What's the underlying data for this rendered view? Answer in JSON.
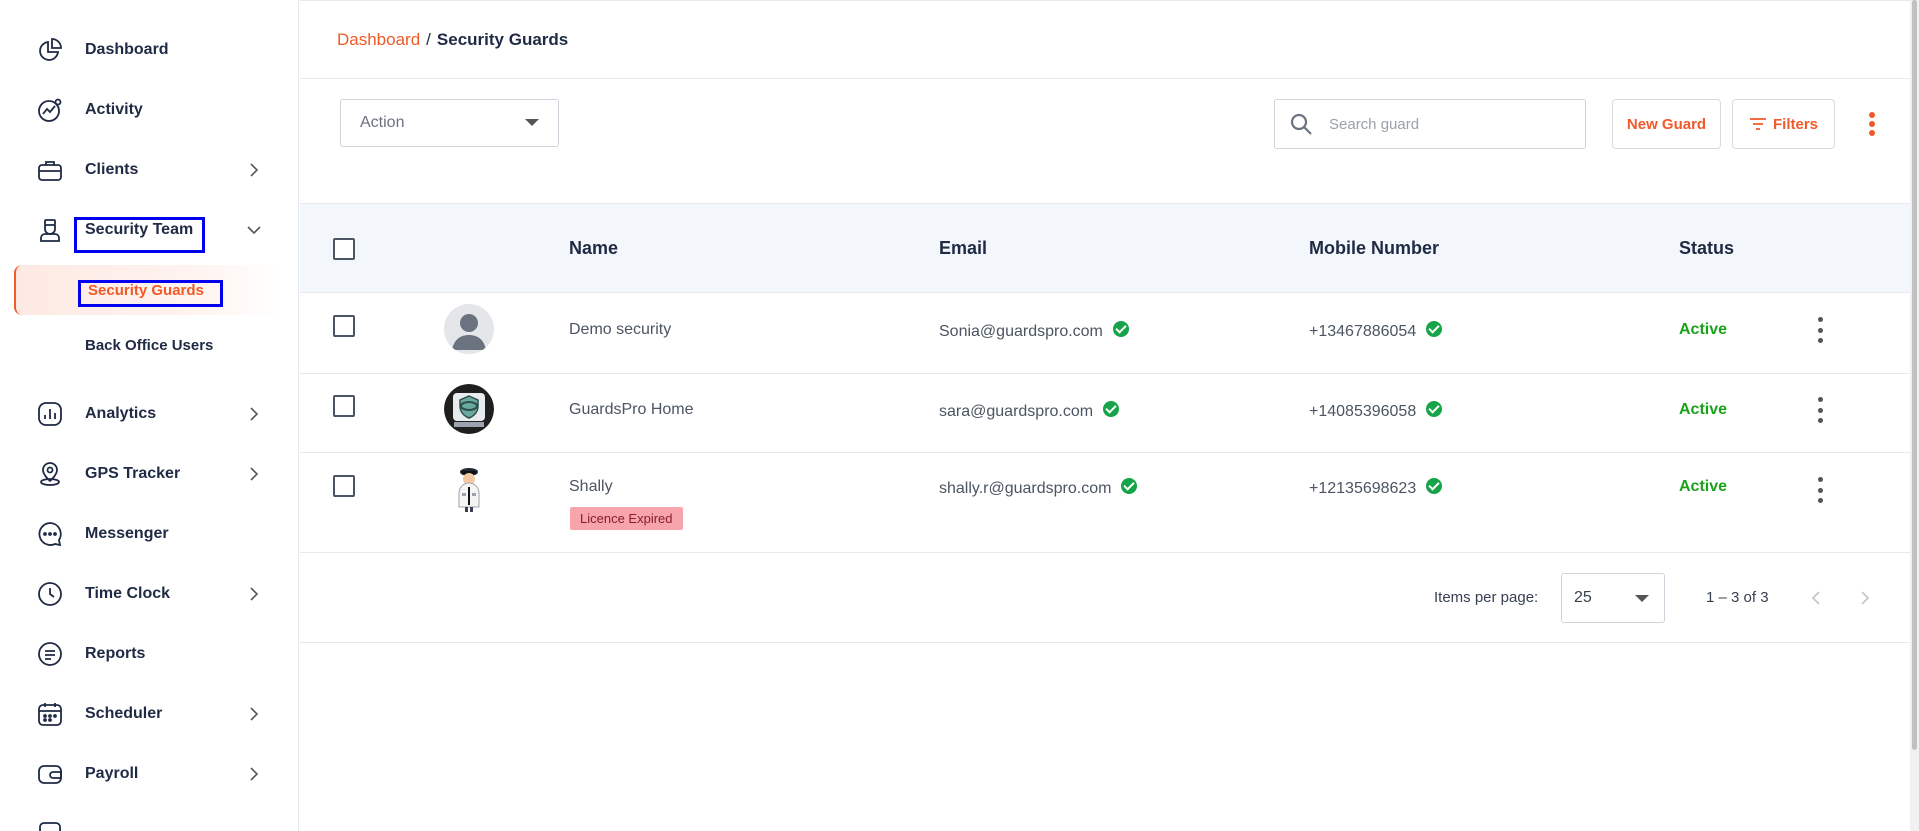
{
  "sidebar": {
    "items": [
      {
        "label": "Dashboard",
        "icon": "dashboard-icon"
      },
      {
        "label": "Activity",
        "icon": "activity-icon"
      },
      {
        "label": "Clients",
        "icon": "clients-icon"
      },
      {
        "label": "Security Team",
        "icon": "security-team-icon"
      },
      {
        "label": "Analytics",
        "icon": "analytics-icon"
      },
      {
        "label": "GPS Tracker",
        "icon": "gps-tracker-icon"
      },
      {
        "label": "Messenger",
        "icon": "messenger-icon"
      },
      {
        "label": "Time Clock",
        "icon": "time-clock-icon"
      },
      {
        "label": "Reports",
        "icon": "reports-icon"
      },
      {
        "label": "Scheduler",
        "icon": "scheduler-icon"
      },
      {
        "label": "Payroll",
        "icon": "payroll-icon"
      }
    ],
    "sub_items": [
      {
        "label": "Security Guards",
        "active": true
      },
      {
        "label": "Back Office Users",
        "active": false
      }
    ]
  },
  "header": {
    "breadcrumb_link": "Dashboard",
    "breadcrumb_sep": "/",
    "breadcrumb_current": "Security Guards"
  },
  "toolbar": {
    "action_label": "Action",
    "search_placeholder": "Search guard",
    "new_guard_label": "New Guard",
    "filters_label": "Filters"
  },
  "table": {
    "columns": [
      "Name",
      "Email",
      "Mobile Number",
      "Status"
    ],
    "rows": [
      {
        "name": "Demo security",
        "email": "Sonia@guardspro.com",
        "mobile": "+13467886054",
        "status": "Active",
        "badge": ""
      },
      {
        "name": "GuardsPro Home",
        "email": "sara@guardspro.com",
        "mobile": "+14085396058",
        "status": "Active",
        "badge": ""
      },
      {
        "name": "Shally",
        "email": "shally.r@guardspro.com",
        "mobile": "+12135698623",
        "status": "Active",
        "badge": "Licence Expired"
      }
    ]
  },
  "pagination": {
    "items_per_page_label": "Items per page:",
    "items_per_page_value": "25",
    "range_label": "1 – 3 of 3"
  },
  "colors": {
    "accent": "#f05a28",
    "status_active": "#1aa31a",
    "verified": "#16a34a",
    "badge_bg": "#f7a4ad",
    "highlight_box": "#0000ee"
  }
}
